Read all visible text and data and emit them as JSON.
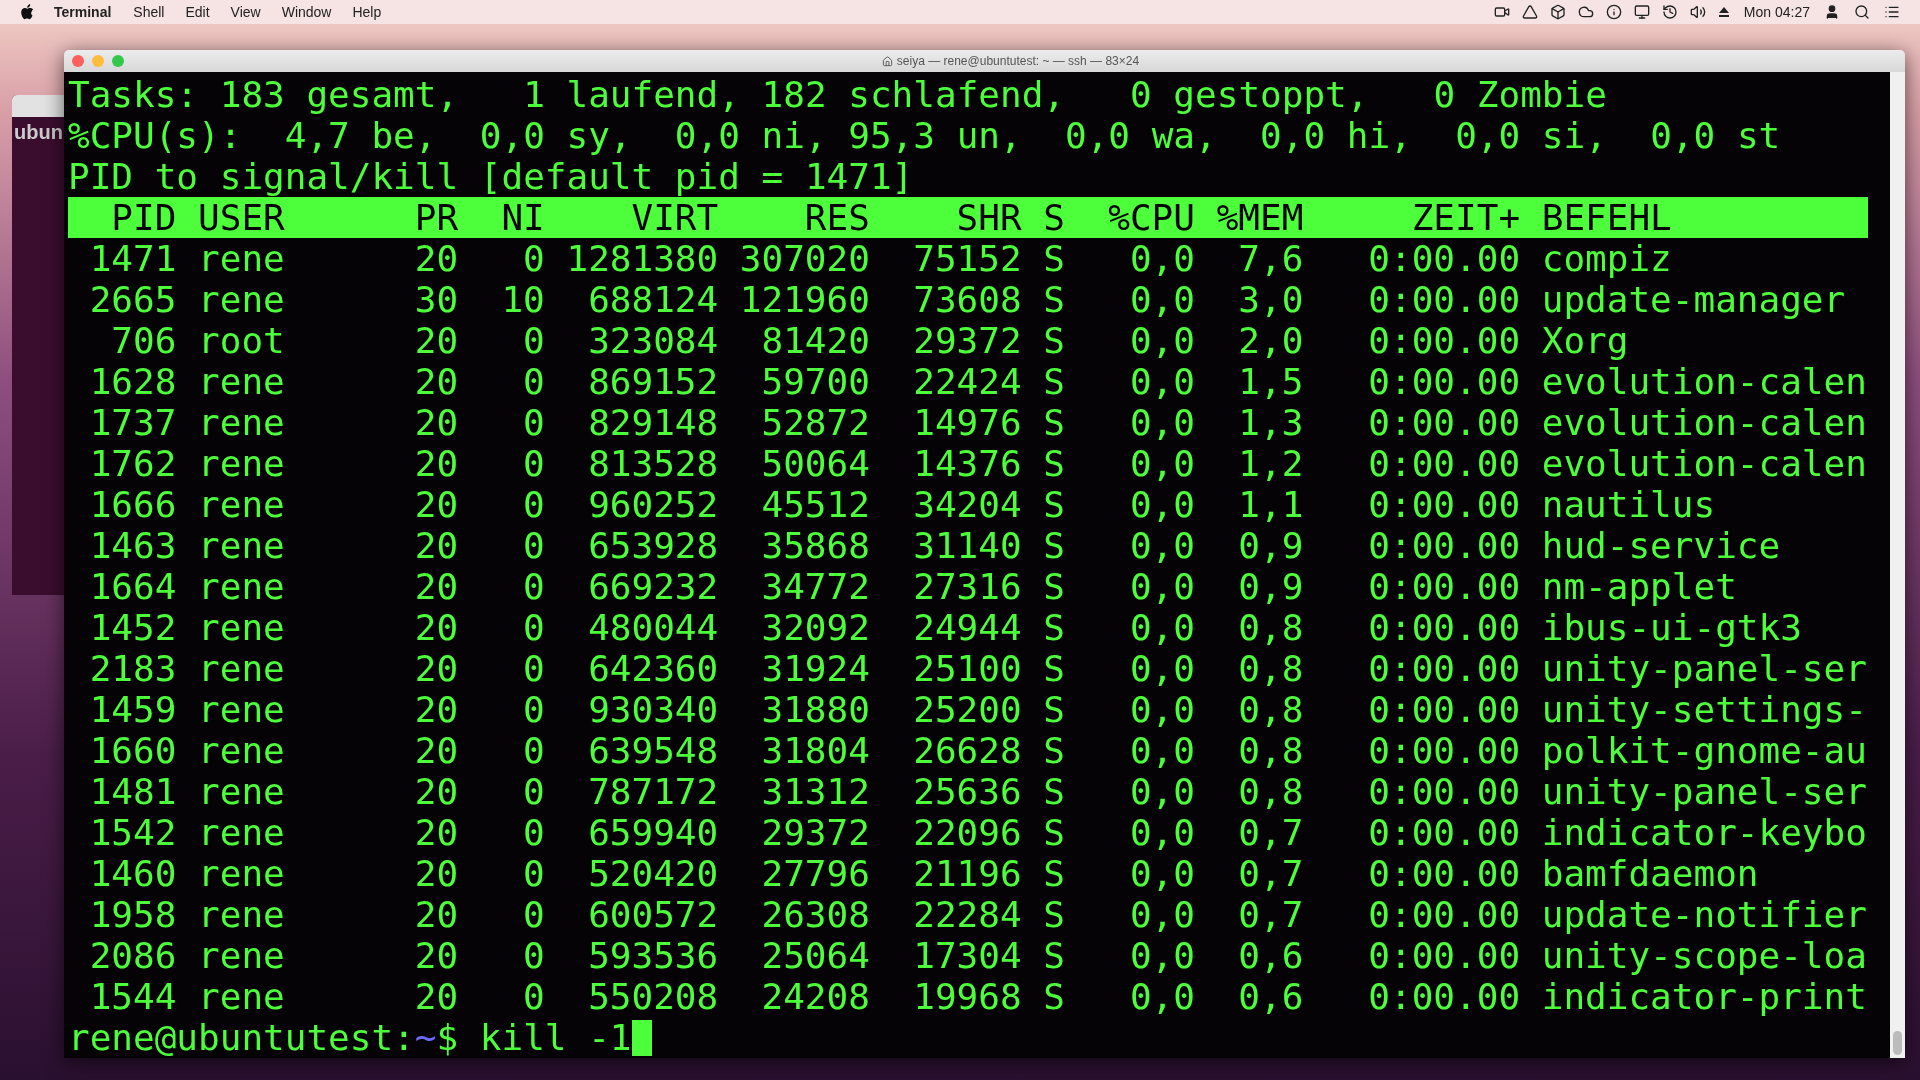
{
  "menu_bar": {
    "app_menu": "Terminal",
    "menus": [
      "Shell",
      "Edit",
      "View",
      "Window",
      "Help"
    ],
    "clock": "Mon 04:27"
  },
  "background_window": {
    "text": "ubun"
  },
  "window": {
    "title": "seiya — rene@ubuntutest: ~ — ssh — 83×24"
  },
  "terminal": {
    "summary_lines": [
      "Tasks: 183 gesamt,   1 laufend, 182 schlafend,   0 gestoppt,   0 Zombie",
      "%CPU(s):  4,7 be,  0,0 sy,  0,0 ni, 95,3 un,  0,0 wa,  0,0 hi,  0,0 si,  0,0 st",
      "PID to signal/kill [default pid = 1471]"
    ],
    "columns": [
      "PID",
      "USER",
      "PR",
      "NI",
      "VIRT",
      "RES",
      "SHR",
      "S",
      "%CPU",
      "%MEM",
      "ZEIT+",
      "BEFEHL"
    ],
    "rows": [
      [
        "1471",
        "rene",
        "20",
        "0",
        "1281380",
        "307020",
        "75152",
        "S",
        "0,0",
        "7,6",
        "0:00.00",
        "compiz"
      ],
      [
        "2665",
        "rene",
        "30",
        "10",
        "688124",
        "121960",
        "73608",
        "S",
        "0,0",
        "3,0",
        "0:00.00",
        "update-manager"
      ],
      [
        "706",
        "root",
        "20",
        "0",
        "323084",
        "81420",
        "29372",
        "S",
        "0,0",
        "2,0",
        "0:00.00",
        "Xorg"
      ],
      [
        "1628",
        "rene",
        "20",
        "0",
        "869152",
        "59700",
        "22424",
        "S",
        "0,0",
        "1,5",
        "0:00.00",
        "evolution-calen"
      ],
      [
        "1737",
        "rene",
        "20",
        "0",
        "829148",
        "52872",
        "14976",
        "S",
        "0,0",
        "1,3",
        "0:00.00",
        "evolution-calen"
      ],
      [
        "1762",
        "rene",
        "20",
        "0",
        "813528",
        "50064",
        "14376",
        "S",
        "0,0",
        "1,2",
        "0:00.00",
        "evolution-calen"
      ],
      [
        "1666",
        "rene",
        "20",
        "0",
        "960252",
        "45512",
        "34204",
        "S",
        "0,0",
        "1,1",
        "0:00.00",
        "nautilus"
      ],
      [
        "1463",
        "rene",
        "20",
        "0",
        "653928",
        "35868",
        "31140",
        "S",
        "0,0",
        "0,9",
        "0:00.00",
        "hud-service"
      ],
      [
        "1664",
        "rene",
        "20",
        "0",
        "669232",
        "34772",
        "27316",
        "S",
        "0,0",
        "0,9",
        "0:00.00",
        "nm-applet"
      ],
      [
        "1452",
        "rene",
        "20",
        "0",
        "480044",
        "32092",
        "24944",
        "S",
        "0,0",
        "0,8",
        "0:00.00",
        "ibus-ui-gtk3"
      ],
      [
        "2183",
        "rene",
        "20",
        "0",
        "642360",
        "31924",
        "25100",
        "S",
        "0,0",
        "0,8",
        "0:00.00",
        "unity-panel-ser"
      ],
      [
        "1459",
        "rene",
        "20",
        "0",
        "930340",
        "31880",
        "25200",
        "S",
        "0,0",
        "0,8",
        "0:00.00",
        "unity-settings-"
      ],
      [
        "1660",
        "rene",
        "20",
        "0",
        "639548",
        "31804",
        "26628",
        "S",
        "0,0",
        "0,8",
        "0:00.00",
        "polkit-gnome-au"
      ],
      [
        "1481",
        "rene",
        "20",
        "0",
        "787172",
        "31312",
        "25636",
        "S",
        "0,0",
        "0,8",
        "0:00.00",
        "unity-panel-ser"
      ],
      [
        "1542",
        "rene",
        "20",
        "0",
        "659940",
        "29372",
        "22096",
        "S",
        "0,0",
        "0,7",
        "0:00.00",
        "indicator-keybo"
      ],
      [
        "1460",
        "rene",
        "20",
        "0",
        "520420",
        "27796",
        "21196",
        "S",
        "0,0",
        "0,7",
        "0:00.00",
        "bamfdaemon"
      ],
      [
        "1958",
        "rene",
        "20",
        "0",
        "600572",
        "26308",
        "22284",
        "S",
        "0,0",
        "0,7",
        "0:00.00",
        "update-notifier"
      ],
      [
        "2086",
        "rene",
        "20",
        "0",
        "593536",
        "25064",
        "17304",
        "S",
        "0,0",
        "0,6",
        "0:00.00",
        "unity-scope-loa"
      ],
      [
        "1544",
        "rene",
        "20",
        "0",
        "550208",
        "24208",
        "19968",
        "S",
        "0,0",
        "0,6",
        "0:00.00",
        "indicator-print"
      ]
    ],
    "prompt": {
      "user_host": "rene@ubuntutest:",
      "path": "~",
      "command": "$ kill -1"
    }
  }
}
